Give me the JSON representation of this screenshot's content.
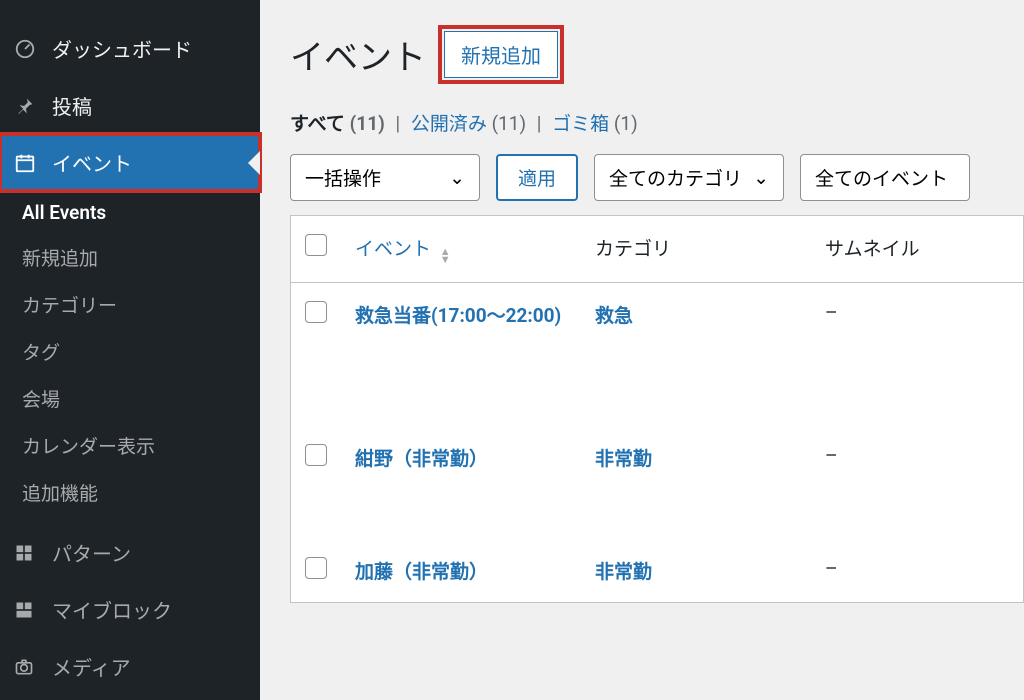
{
  "sidebar": {
    "items": [
      {
        "label": "ダッシュボード",
        "icon": "dashboard"
      },
      {
        "label": "投稿",
        "icon": "pin"
      },
      {
        "label": "イベント",
        "icon": "calendar"
      },
      {
        "label": "パターン",
        "icon": "grid"
      },
      {
        "label": "マイブロック",
        "icon": "blocks"
      },
      {
        "label": "メディア",
        "icon": "camera"
      }
    ],
    "submenu": [
      {
        "label": "All Events",
        "current": true
      },
      {
        "label": "新規追加"
      },
      {
        "label": "カテゴリー"
      },
      {
        "label": "タグ"
      },
      {
        "label": "会場"
      },
      {
        "label": "カレンダー表示"
      },
      {
        "label": "追加機能"
      }
    ]
  },
  "header": {
    "title": "イベント",
    "add_new": "新規追加"
  },
  "status_links": {
    "all_label": "すべて",
    "all_count": "(11)",
    "published_label": "公開済み",
    "published_count": "(11)",
    "trash_label": "ゴミ箱",
    "trash_count": "(1)"
  },
  "filters": {
    "bulk_action": "一括操作",
    "apply": "適用",
    "category_filter": "全てのカテゴリ",
    "event_filter": "全てのイベント"
  },
  "table": {
    "columns": {
      "title": "イベント",
      "category": "カテゴリ",
      "thumbnail": "サムネイル"
    },
    "rows": [
      {
        "title": "救急当番(17:00〜22:00)",
        "category": "救急",
        "thumbnail": "–"
      },
      {
        "title": "紺野（非常勤）",
        "category": "非常勤",
        "thumbnail": "–"
      },
      {
        "title": "加藤（非常勤）",
        "category": "非常勤",
        "thumbnail": "–"
      }
    ]
  }
}
